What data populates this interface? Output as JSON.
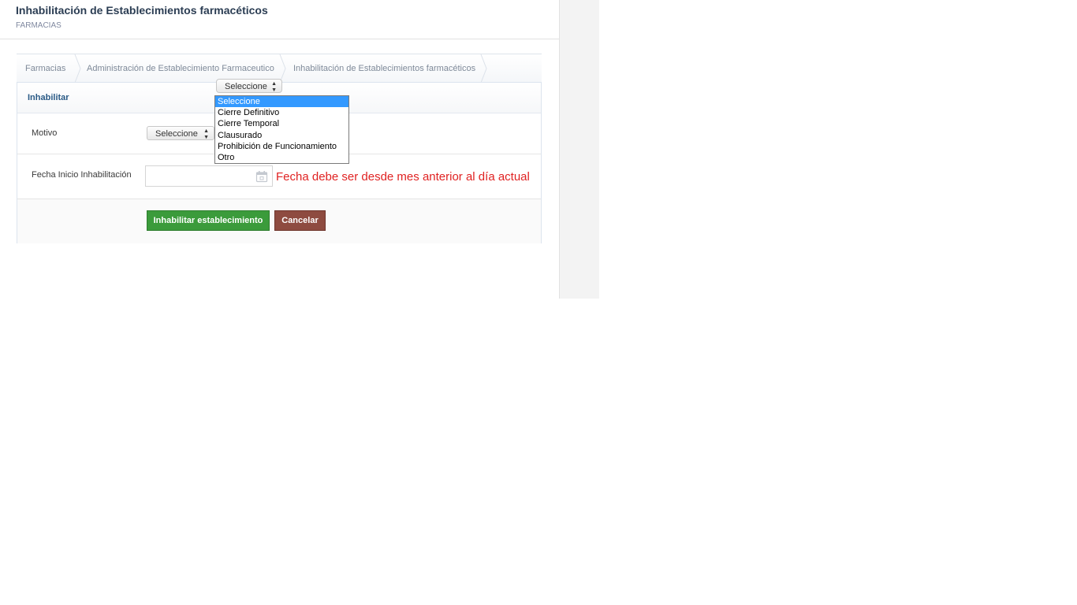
{
  "header": {
    "title": "Inhabilitación de Establecimientos farmacéticos",
    "subtitle": "FARMACIAS"
  },
  "breadcrumb": {
    "items": [
      {
        "label": "Farmacias"
      },
      {
        "label": "Administración de Establecimiento Farmaceutico"
      },
      {
        "label": "Inhabilitación de Establecimientos farmacéticos"
      }
    ]
  },
  "card": {
    "title": "Inhabilitar"
  },
  "form": {
    "motivo_label": "Motivo",
    "motivo_select_value": "Seleccione",
    "fecha_label": "Fecha Inicio Inhabilitación",
    "fecha_value": "",
    "fecha_error": "Fecha debe ser desde mes anterior al día actual"
  },
  "popup_select": {
    "value": "Seleccione",
    "options": [
      {
        "label": "Seleccione",
        "selected": true
      },
      {
        "label": "Cierre Definitivo",
        "selected": false
      },
      {
        "label": "Cierre Temporal",
        "selected": false
      },
      {
        "label": "Clausurado",
        "selected": false
      },
      {
        "label": "Prohibición de Funcionamiento",
        "selected": false
      },
      {
        "label": "Otro",
        "selected": false
      }
    ]
  },
  "actions": {
    "submit_label": "Inhabilitar establecimiento",
    "cancel_label": "Cancelar"
  },
  "icons": {
    "date": "calendar-icon",
    "select_arrows": "sort-arrows-icon"
  },
  "colors": {
    "submit_button": "#3b9b3b",
    "cancel_button": "#8e4b40",
    "error_text": "#e02222",
    "selected_option": "#3399ff",
    "title": "#2b3d53"
  }
}
